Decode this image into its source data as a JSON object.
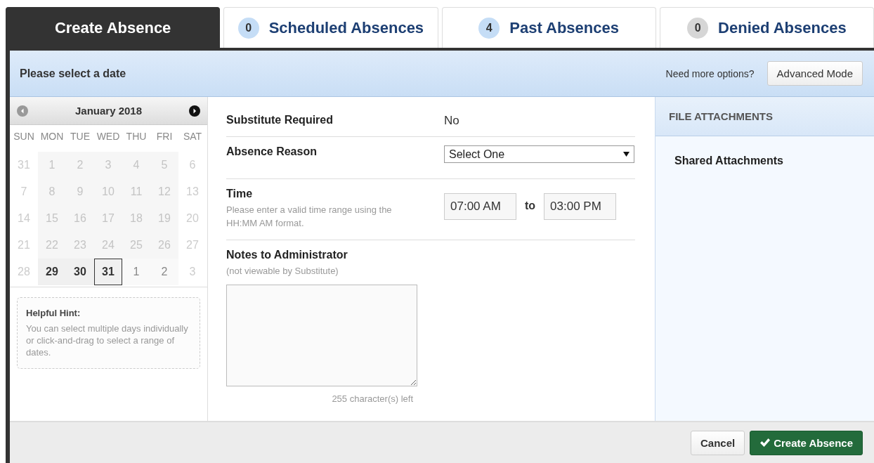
{
  "tabs": [
    {
      "label": "Create Absence",
      "selected": true
    },
    {
      "label": "Scheduled Absences",
      "count": "0",
      "color": "#c5ddf6",
      "selected": false
    },
    {
      "label": "Past Absences",
      "count": "4",
      "color": "#c5ddf6",
      "selected": false
    },
    {
      "label": "Denied Absences",
      "count": "0",
      "color": "#d6d6d6",
      "selected": false
    }
  ],
  "header": {
    "title": "Please select a date",
    "options_prompt": "Need more options?",
    "advanced_button": "Advanced Mode"
  },
  "calendar": {
    "month": "January 2018",
    "weekdays": [
      "SUN",
      "MON",
      "TUE",
      "WED",
      "THU",
      "FRI",
      "SAT"
    ],
    "days": [
      {
        "label": "31",
        "kind": "weekend",
        "selected": false
      },
      {
        "label": "1",
        "kind": "disabled",
        "selected": false
      },
      {
        "label": "2",
        "kind": "disabled",
        "selected": false
      },
      {
        "label": "3",
        "kind": "disabled",
        "selected": false
      },
      {
        "label": "4",
        "kind": "disabled",
        "selected": false
      },
      {
        "label": "5",
        "kind": "disabled",
        "selected": false
      },
      {
        "label": "6",
        "kind": "weekend",
        "selected": false
      },
      {
        "label": "7",
        "kind": "weekend",
        "selected": false
      },
      {
        "label": "8",
        "kind": "disabled",
        "selected": false
      },
      {
        "label": "9",
        "kind": "disabled",
        "selected": false
      },
      {
        "label": "10",
        "kind": "disabled",
        "selected": false
      },
      {
        "label": "11",
        "kind": "disabled",
        "selected": false
      },
      {
        "label": "12",
        "kind": "disabled",
        "selected": false
      },
      {
        "label": "13",
        "kind": "weekend",
        "selected": false
      },
      {
        "label": "14",
        "kind": "weekend",
        "selected": false
      },
      {
        "label": "15",
        "kind": "disabled",
        "selected": false
      },
      {
        "label": "16",
        "kind": "disabled",
        "selected": false
      },
      {
        "label": "17",
        "kind": "disabled",
        "selected": false
      },
      {
        "label": "18",
        "kind": "disabled",
        "selected": false
      },
      {
        "label": "19",
        "kind": "disabled",
        "selected": false
      },
      {
        "label": "20",
        "kind": "weekend",
        "selected": false
      },
      {
        "label": "21",
        "kind": "weekend",
        "selected": false
      },
      {
        "label": "22",
        "kind": "disabled",
        "selected": false
      },
      {
        "label": "23",
        "kind": "disabled",
        "selected": false
      },
      {
        "label": "24",
        "kind": "disabled",
        "selected": false
      },
      {
        "label": "25",
        "kind": "disabled",
        "selected": false
      },
      {
        "label": "26",
        "kind": "disabled",
        "selected": false
      },
      {
        "label": "27",
        "kind": "weekend",
        "selected": false
      },
      {
        "label": "28",
        "kind": "weekend",
        "selected": false
      },
      {
        "label": "29",
        "kind": "available",
        "selected": false
      },
      {
        "label": "30",
        "kind": "available",
        "selected": false
      },
      {
        "label": "31",
        "kind": "available",
        "selected": true
      },
      {
        "label": "1",
        "kind": "next",
        "selected": false
      },
      {
        "label": "2",
        "kind": "next",
        "selected": false
      },
      {
        "label": "3",
        "kind": "weekend",
        "selected": false
      }
    ]
  },
  "hint": {
    "title": "Helpful Hint:",
    "text": "You can select multiple days individually or click-and-drag to select a range of dates."
  },
  "form": {
    "substitute_label": "Substitute Required",
    "substitute_value": "No",
    "reason_label": "Absence Reason",
    "reason_value": "Select One",
    "time_label": "Time",
    "time_help": "Please enter a valid time range using the HH:MM AM format.",
    "time_start": "07:00 AM",
    "time_separator": "to",
    "time_end": "03:00 PM",
    "notes_label": "Notes to Administrator",
    "notes_help": "(not viewable by Substitute)",
    "notes_counter": "255 character(s) left"
  },
  "attachments": {
    "title": "FILE ATTACHMENTS",
    "section": "Shared Attachments"
  },
  "footer": {
    "cancel": "Cancel",
    "submit": "Create Absence"
  }
}
